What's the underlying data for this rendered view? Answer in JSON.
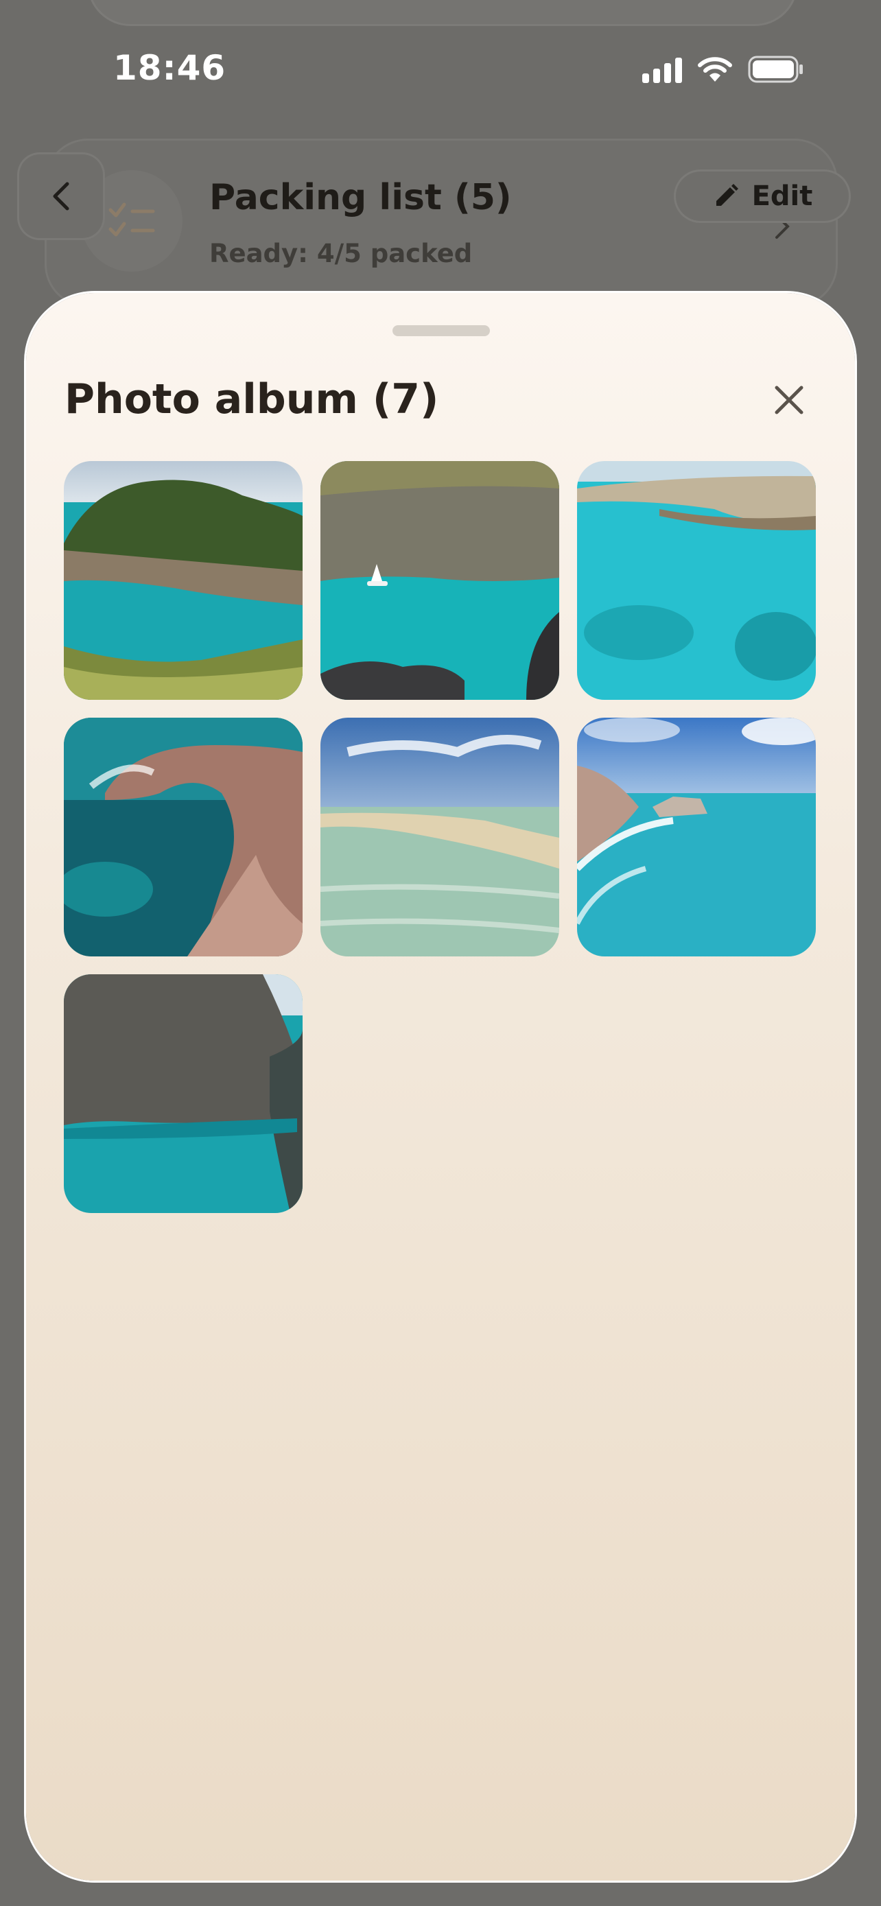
{
  "status_bar": {
    "time": "18:46"
  },
  "background_screen": {
    "title": "Packing list (5)",
    "subtitle": "Ready: 4/5 packed",
    "edit_label": "Edit"
  },
  "sheet": {
    "title": "Photo album (7)",
    "photos": [
      {
        "icon": "photo-rocky-island-cove"
      },
      {
        "icon": "photo-sailboat-cliff-bay"
      },
      {
        "icon": "photo-turquoise-sea-cliffs"
      },
      {
        "icon": "photo-rock-arch"
      },
      {
        "icon": "photo-shallow-beach"
      },
      {
        "icon": "photo-coastline-waves"
      },
      {
        "icon": "photo-gorge-cove"
      }
    ]
  }
}
